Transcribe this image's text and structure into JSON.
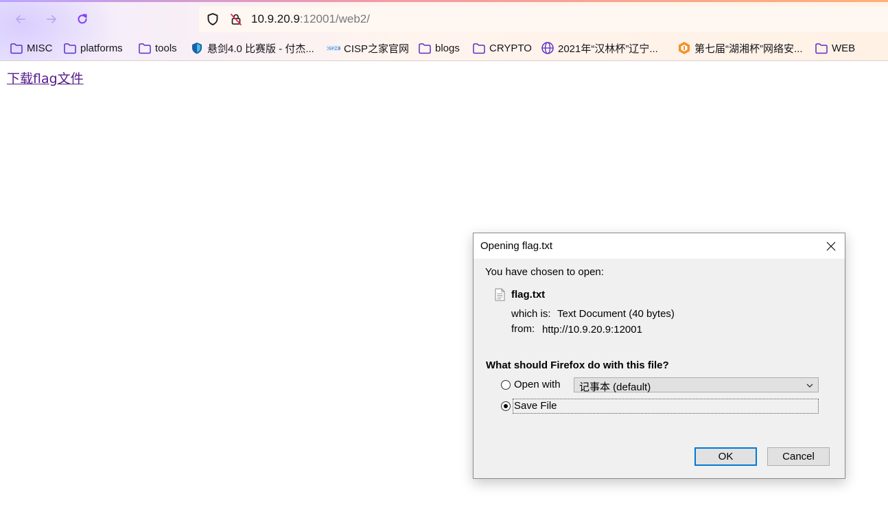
{
  "browser": {
    "url_host": "10.9.20.9",
    "url_rest": ":12001/web2/",
    "bookmarks": [
      {
        "label": "MISC",
        "icon": "folder-icon"
      },
      {
        "label": "platforms",
        "icon": "folder-icon"
      },
      {
        "label": "tools",
        "icon": "folder-icon"
      },
      {
        "label": "悬剑4.0 比赛版 - 付杰...",
        "icon": "shield-logo-icon"
      },
      {
        "label": "CISP之家官网",
        "icon": "cisp-logo-icon"
      },
      {
        "label": "blogs",
        "icon": "folder-icon"
      },
      {
        "label": "CRYPTO",
        "icon": "folder-icon"
      },
      {
        "label": "2021年“汉林杯”辽宁...",
        "icon": "globe-icon"
      },
      {
        "label": "第七届“湖湘杯”网络安...",
        "icon": "hexagon-logo-icon"
      },
      {
        "label": "WEB",
        "icon": "folder-icon"
      }
    ],
    "colors": {
      "accent": "#8f5cf7",
      "link_visited": "#551a8b",
      "focus": "#0078d7"
    }
  },
  "page": {
    "link_text": "下载flag文件"
  },
  "dialog": {
    "title": "Opening flag.txt",
    "intro": "You have chosen to open:",
    "file_name": "flag.txt",
    "which_is_label": "which is:",
    "which_is_value": "Text Document (40 bytes)",
    "from_label": "from:",
    "from_value": "http://10.9.20.9:12001",
    "question": "What should Firefox do with this file?",
    "open_with_label": "Open with",
    "open_with_value": "记事本 (default)",
    "save_file_label": "Save File",
    "selected_option": "Save File",
    "ok_label": "OK",
    "cancel_label": "Cancel"
  }
}
